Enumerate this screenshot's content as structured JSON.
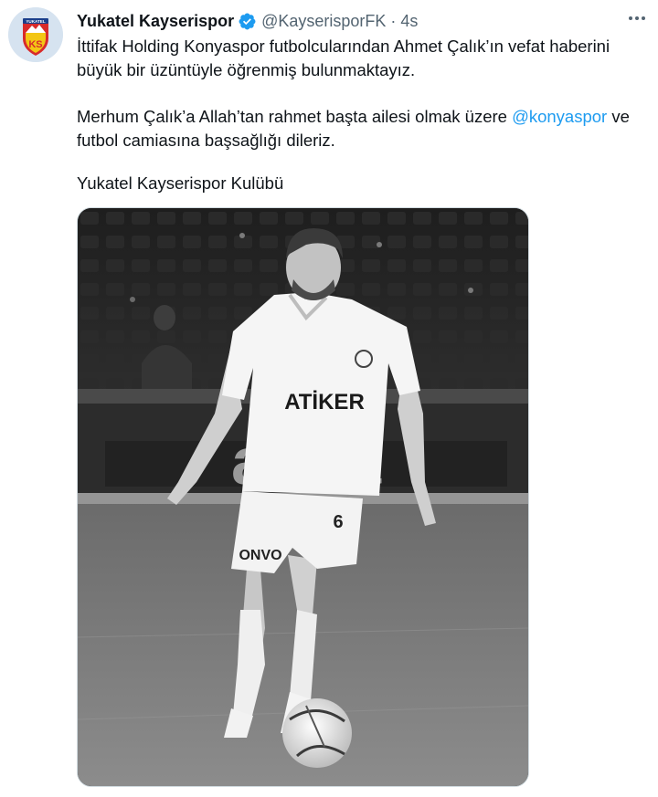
{
  "tweet": {
    "display_name": "Yukatel Kayserispor",
    "handle": "@KayserisporFK",
    "separator": "·",
    "time": "4s",
    "paragraph1_line1": "İttifak Holding Konyaspor futbolcularından Ahmet Çalık’ın vefat haberini",
    "paragraph1_line2": "büyük bir üzüntüyle öğrenmiş bulunmaktayız.",
    "paragraph2_line1_before": "Merhum Çalık’a Allah’tan rahmet başta ailesi olmak üzere ",
    "paragraph2_mention": "@konyaspor",
    "paragraph2_line1_after": " ve",
    "paragraph2_line2": "futbol camiasına başsağlığı dileriz.",
    "paragraph3": "Yukatel Kayserispor Kulübü"
  },
  "avatar": {
    "sponsor_text": "YUKATEL",
    "crest_text": "KS"
  },
  "photo": {
    "jersey_sponsor": "ATİKER",
    "shorts_text": "ONVO",
    "shirt_number": "6",
    "board_text": "ansa"
  },
  "colors": {
    "accent": "#1d9bf0",
    "text": "#0f1419",
    "secondary": "#536471",
    "crest_red": "#d82a2a",
    "crest_yellow": "#f3c614"
  },
  "icons": {
    "verified": "verified-badge-icon",
    "more": "more-options-icon"
  }
}
